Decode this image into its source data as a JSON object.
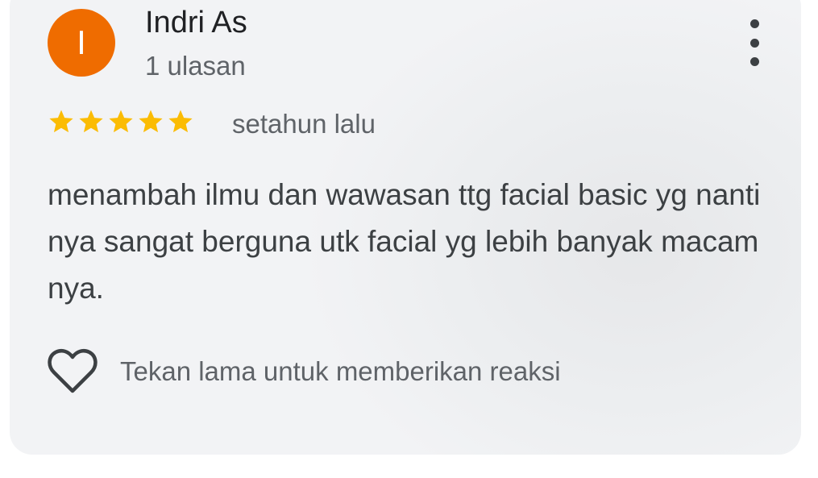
{
  "review": {
    "author_initial": "I",
    "author_name": "Indri As",
    "author_reviews": "1 ulasan",
    "rating": 5,
    "rating_max": 5,
    "time": "setahun lalu",
    "text": "menambah ilmu dan wawasan ttg facial basic yg nanti nya sangat berguna utk facial yg lebih banyak macam nya.",
    "reaction_hint": "Tekan lama untuk memberikan reaksi"
  },
  "icons": {
    "menu": "more-vert-icon",
    "star": "star-icon",
    "reaction": "heart-outline-icon"
  },
  "colors": {
    "avatar": "#ef6c00",
    "star": "#fbbc04",
    "card_bg": "#f2f3f5",
    "primary_text": "#202124",
    "secondary_text": "#5f6368"
  }
}
